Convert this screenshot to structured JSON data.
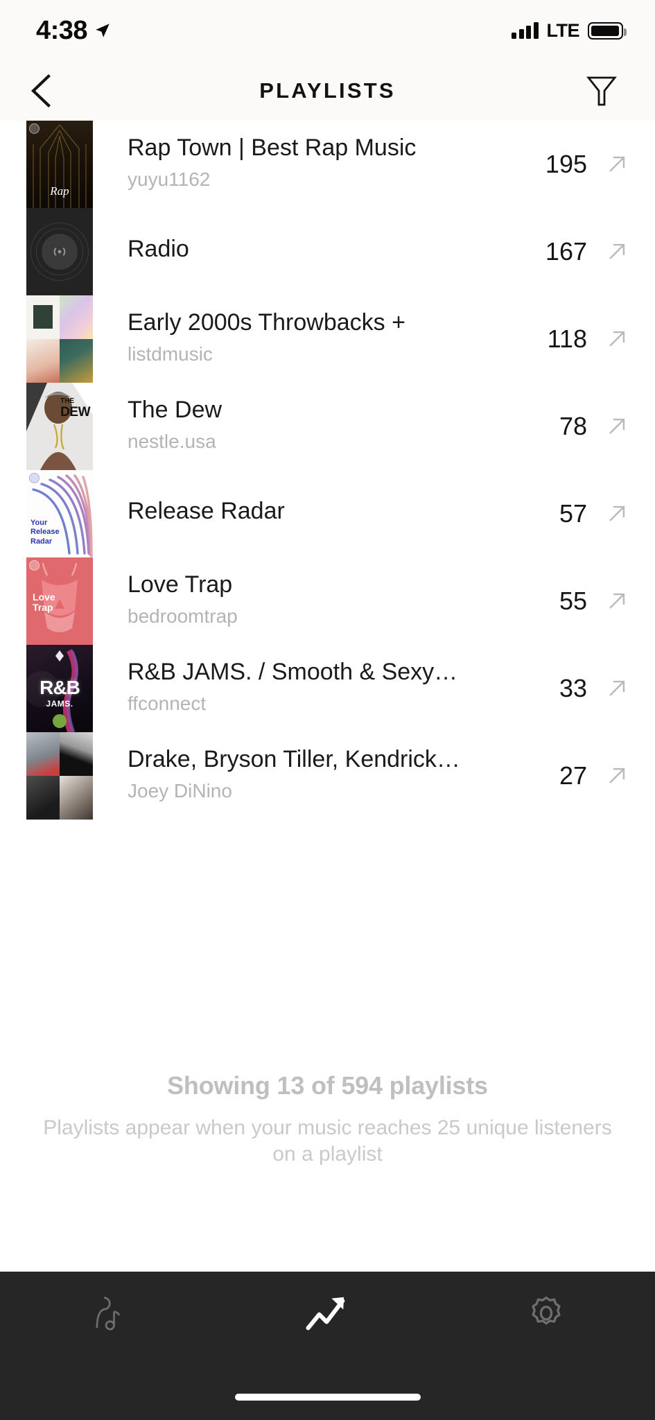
{
  "status_bar": {
    "time": "4:38",
    "location_icon": "location-arrow-icon",
    "signal_icon": "cellular-signal-icon",
    "network": "LTE",
    "battery_icon": "battery-full-icon"
  },
  "nav": {
    "back_icon": "chevron-left-icon",
    "title": "PLAYLISTS",
    "filter_icon": "funnel-filter-icon"
  },
  "list": {
    "rows": [
      {
        "title": "Rap Town | Best Rap Music",
        "subtitle": "yuyu1162",
        "count": "195",
        "art": "rap",
        "art_label": "Rap",
        "arrow_icon": "arrow-up-right-icon"
      },
      {
        "title": "Radio",
        "subtitle": "",
        "count": "167",
        "art": "radio",
        "art_label": "",
        "arrow_icon": "arrow-up-right-icon"
      },
      {
        "title": "Early 2000s Throwbacks +",
        "subtitle": "listdmusic",
        "count": "118",
        "art": "mosaic-throwbacks",
        "art_label": "",
        "arrow_icon": "arrow-up-right-icon"
      },
      {
        "title": "The Dew",
        "subtitle": "nestle.usa",
        "count": "78",
        "art": "dew",
        "art_label": "THE DEW",
        "arrow_icon": "arrow-up-right-icon"
      },
      {
        "title": "Release Radar",
        "subtitle": "",
        "count": "57",
        "art": "radar",
        "art_label": "Your Release Radar",
        "arrow_icon": "arrow-up-right-icon"
      },
      {
        "title": "Love Trap",
        "subtitle": "bedroomtrap",
        "count": "55",
        "art": "lovetrap",
        "art_label": "Love Trap",
        "arrow_icon": "arrow-up-right-icon"
      },
      {
        "title": "R&B JAMS. / Smooth & Sexy…",
        "subtitle": "ffconnect",
        "count": "33",
        "art": "rnb",
        "art_label": "R&B JAMS.",
        "arrow_icon": "arrow-up-right-icon"
      },
      {
        "title": "Drake, Bryson Tiller, Kendrick…",
        "subtitle": "Joey DiNino",
        "count": "27",
        "art": "mosaic-drake",
        "art_label": "",
        "arrow_icon": "arrow-up-right-icon"
      }
    ]
  },
  "footer": {
    "showing": "Showing 13 of 594 playlists",
    "hint": "Playlists appear when your music reaches 25 unique listeners on a playlist"
  },
  "tabbar": {
    "tabs": [
      {
        "name": "artist",
        "icon": "artist-music-icon",
        "active": false
      },
      {
        "name": "trends",
        "icon": "trending-up-arrow-icon",
        "active": true
      },
      {
        "name": "settings",
        "icon": "gear-icon",
        "active": false
      }
    ],
    "home_indicator": "home-indicator"
  },
  "colors": {
    "background": "#ffffff",
    "nav_background": "#fbfaf8",
    "title": "#121212",
    "row_title": "#1a1a1a",
    "row_subtitle": "#b4b4b4",
    "footer_text": "#bfbfbf",
    "tabbar_background": "#262626",
    "tab_active": "#ffffff",
    "tab_inactive": "#6e6e6e"
  }
}
